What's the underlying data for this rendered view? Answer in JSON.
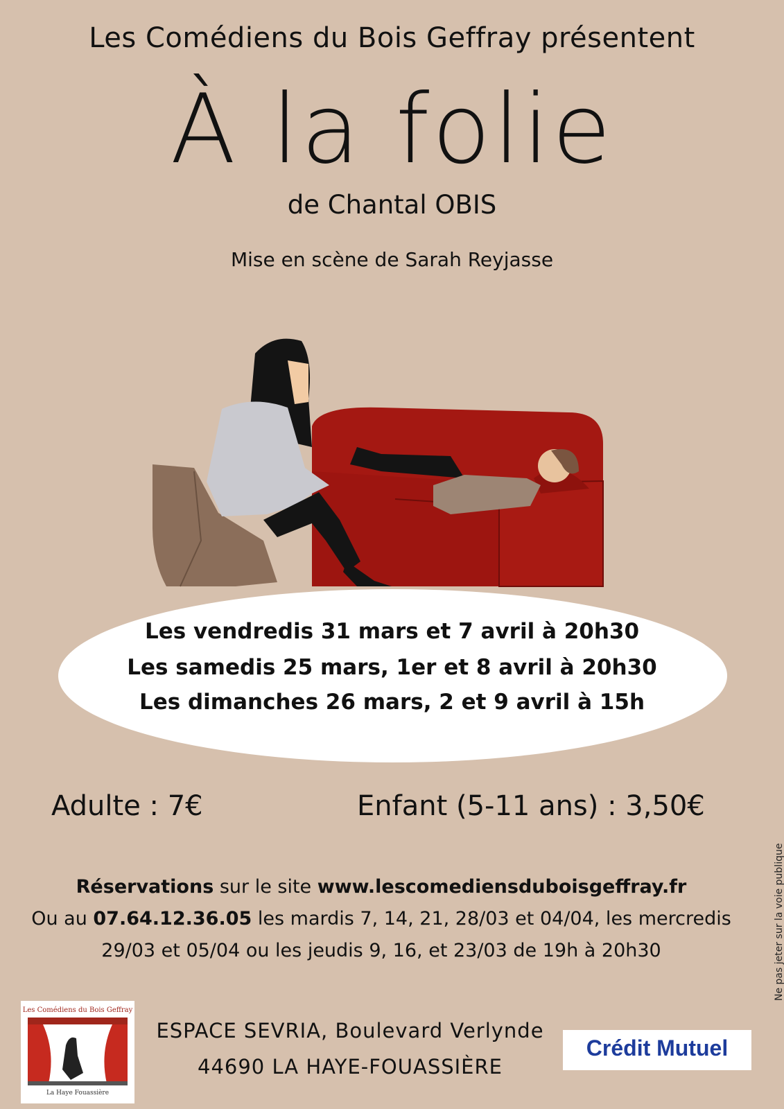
{
  "header": {
    "presenter": "Les Comédiens du Bois Geffray présentent",
    "title": "À la folie",
    "author": "de Chantal OBIS",
    "director": "Mise en scène de Sarah Reyjasse"
  },
  "dates": [
    "Les vendredis 31 mars et 7 avril à 20h30",
    "Les samedis 25 mars, 1er et 8 avril à 20h30",
    "Les dimanches 26 mars, 2 et 9 avril à 15h"
  ],
  "prices": {
    "adult": "Adulte : 7€",
    "child": "Enfant (5-11 ans) : 3,50€"
  },
  "reservations": {
    "line1_bold": "Réservations",
    "line1_text": " sur le site ",
    "website": "www.lescomediensduboisgeffray.fr",
    "line2_prefix": "Ou au ",
    "phone": "07.64.12.36.05",
    "line2_suffix": " les mardis 7, 14, 21, 28/03 et 04/04, les mercredis",
    "line3": "29/03 et 05/04 ou les jeudis 9, 16, et 23/03 de 19h à 20h30"
  },
  "venue": {
    "line1": "ESPACE SEVRIA, Boulevard Verlynde",
    "line2": "44690 LA HAYE-FOUASSIÈRE"
  },
  "logo": {
    "top_text": "Les Comédiens du Bois Geffray",
    "bottom_text": "La Haye Fouassière"
  },
  "sponsor": {
    "name": "Crédit Mutuel"
  },
  "side_note": "Ne pas jeter sur la voie publique",
  "colors": {
    "background": "#d6c0ad",
    "sofa": "#a41812",
    "chair": "#8b6e5a",
    "sweater": "#c9c9cf",
    "sponsor_blue": "#1d3c9c",
    "sponsor_red": "#d21f26"
  }
}
